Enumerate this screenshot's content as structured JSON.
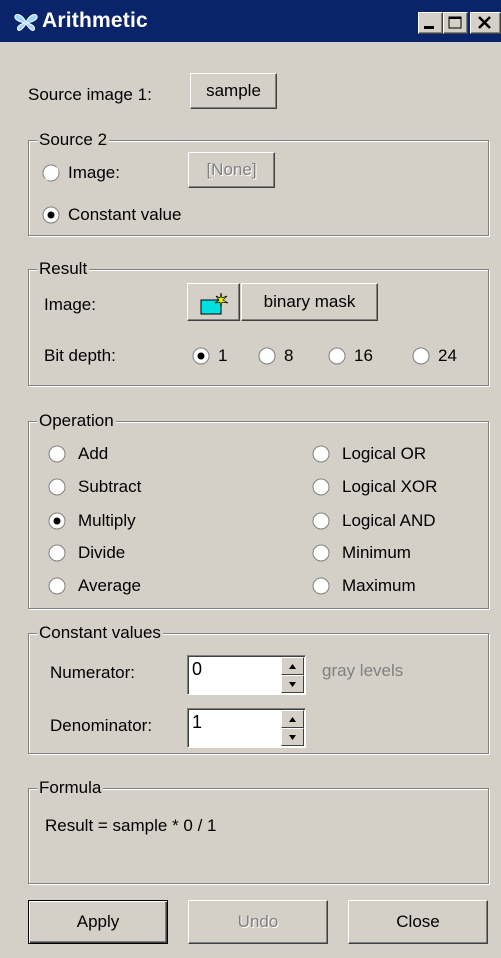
{
  "window": {
    "title": "Arithmetic"
  },
  "source1": {
    "label": "Source image 1:",
    "button": "sample"
  },
  "source2": {
    "legend": "Source 2",
    "image_label": "Image:",
    "image_button": "[None]",
    "constant_label": "Constant value",
    "selected": "constant"
  },
  "result": {
    "legend": "Result",
    "image_label": "Image:",
    "image_button": "binary mask",
    "bitdepth_label": "Bit depth:",
    "bitdepths": [
      "1",
      "8",
      "16",
      "24"
    ],
    "selected_bitdepth": "1"
  },
  "operation": {
    "legend": "Operation",
    "left": [
      "Add",
      "Subtract",
      "Multiply",
      "Divide",
      "Average"
    ],
    "right": [
      "Logical OR",
      "Logical XOR",
      "Logical AND",
      "Minimum",
      "Maximum"
    ],
    "selected": "Multiply"
  },
  "constants": {
    "legend": "Constant values",
    "numerator_label": "Numerator:",
    "numerator_value": "0",
    "units": "gray levels",
    "denominator_label": "Denominator:",
    "denominator_value": "1"
  },
  "formula": {
    "legend": "Formula",
    "text": "Result = sample * 0 / 1"
  },
  "footer": {
    "apply": "Apply",
    "undo": "Undo",
    "close": "Close"
  },
  "colors": {
    "titlebar": "#0a246a",
    "face": "#d4d0c8",
    "new_image_icon": "#00e0e0"
  }
}
